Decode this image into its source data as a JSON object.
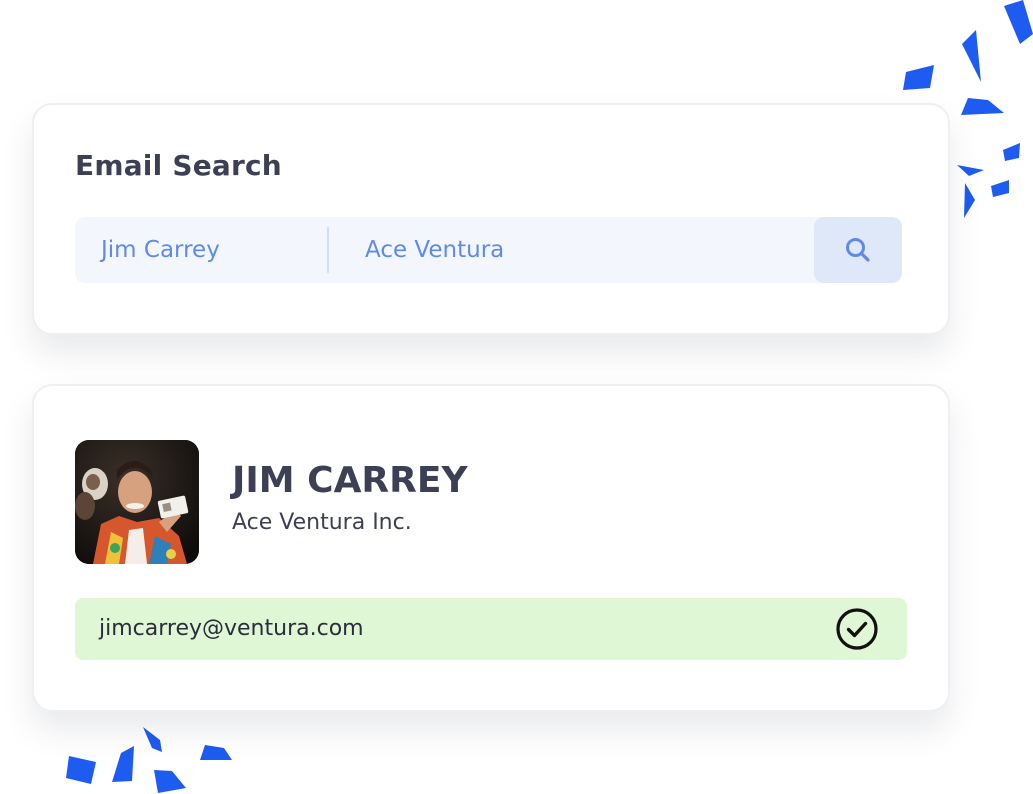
{
  "search_card": {
    "title": "Email Search",
    "name_value": "Jim Carrey",
    "company_value": "Ace Ventura"
  },
  "result_card": {
    "name": "JIM CARREY",
    "company": "Ace Ventura Inc.",
    "email": "jimcarrey@ventura.com",
    "verified_icon": "check-circle-icon"
  },
  "icons": {
    "search": "search-icon"
  },
  "colors": {
    "accent": "#5f8ae6",
    "confetti": "#1e5bf0",
    "success_bg": "#dff7d5",
    "text_dark": "#3d3f55"
  }
}
